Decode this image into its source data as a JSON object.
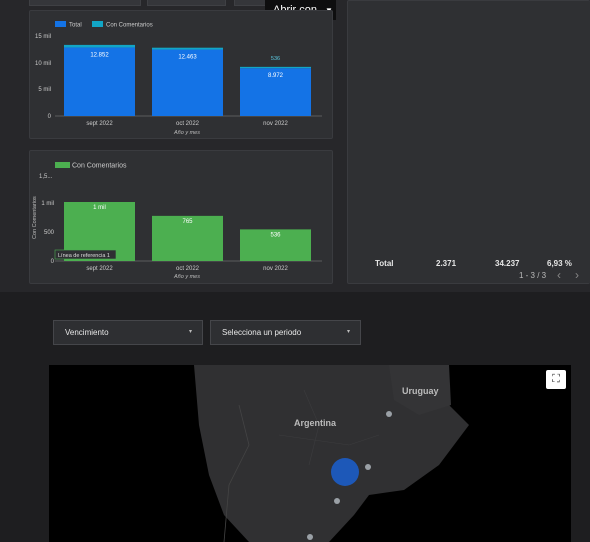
{
  "toolbar": {
    "open_with_label": "Abrir con",
    "caret": "▼"
  },
  "colors": {
    "total": "#1473e6",
    "con_comentarios": "#12a5c5",
    "green": "#4caf50",
    "bg": "#27272a"
  },
  "chart1": {
    "legend": [
      "Total",
      "Con Comentarios"
    ],
    "y_ticks": [
      "15 mil",
      "10 mil",
      "5 mil",
      "0"
    ],
    "xlabel": "Año y mes"
  },
  "chart2": {
    "legend": [
      "Con Comentarios"
    ],
    "y_ticks": [
      "1,5...",
      "1 mil",
      "500",
      "0"
    ],
    "ylabel": "Con Comentarios",
    "xlabel": "Año y mes",
    "reference_line_label": "Línea de referencia 1"
  },
  "chart_data": [
    {
      "type": "bar",
      "categories": [
        "sept 2022",
        "oct 2022",
        "nov 2022"
      ],
      "series": [
        {
          "name": "Total",
          "values": [
            12852,
            12463,
            8972
          ],
          "labels": [
            "12.852",
            "12.463",
            "8.972"
          ]
        },
        {
          "name": "Con Comentarios",
          "values": [
            1066,
            765,
            536
          ],
          "labels": [
            "",
            "",
            "536"
          ]
        }
      ],
      "xlabel": "Año y mes",
      "ylim": [
        0,
        15000
      ],
      "stacked": true
    },
    {
      "type": "bar",
      "categories": [
        "sept 2022",
        "oct 2022",
        "nov 2022"
      ],
      "series": [
        {
          "name": "Con Comentarios",
          "values": [
            1000,
            765,
            536
          ],
          "labels": [
            "1 mil",
            "765",
            "536"
          ]
        }
      ],
      "xlabel": "Año y mes",
      "ylabel": "Con Comentarios",
      "ylim": [
        0,
        1500
      ]
    }
  ],
  "table": {
    "total_label": "Total",
    "v1": "2.371",
    "v2": "34.237",
    "v3": "6,93 %",
    "page": "1 - 3 / 3",
    "prev": "‹",
    "next": "›"
  },
  "filters": {
    "vencimiento": "Vencimiento",
    "periodo": "Selecciona un periodo",
    "arrow": "▾"
  },
  "map": {
    "label_uruguay": "Uruguay",
    "label_argentina": "Argentina",
    "fullscreen_icon": "⛶"
  }
}
